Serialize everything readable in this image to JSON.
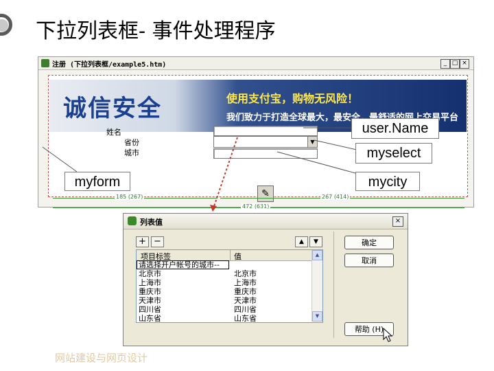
{
  "slide": {
    "title": "下拉列表框- 事件处理程序",
    "footer": "网站建设与网页设计"
  },
  "editor": {
    "title": "注册 (下拉列表框/example5.htm)",
    "controls": [
      "_",
      "□",
      "×"
    ],
    "banner": {
      "logo": "诚信安全",
      "line1": "使用支付宝，购物无风险！",
      "line2": "我们致力于打造全球最大，最安全，最舒适的网上交易平台"
    },
    "fields": [
      {
        "label": "姓名"
      },
      {
        "label": "省份"
      },
      {
        "label": "城市"
      }
    ],
    "rulers": [
      "185 (267)",
      "267 (414)",
      "472 (631)"
    ]
  },
  "callouts": {
    "username": "user.Name",
    "myselect": "myselect",
    "myform": "myform",
    "mycity": "mycity"
  },
  "dialog": {
    "title": "列表值",
    "add": "+",
    "remove": "−",
    "up": "▲",
    "down": "▼",
    "columns": [
      "项目标签",
      "值"
    ],
    "rows": [
      {
        "label": "请选择开户帐号的城市--",
        "value": ""
      },
      {
        "label": "北京市",
        "value": "北京市"
      },
      {
        "label": "上海市",
        "value": "上海市"
      },
      {
        "label": "重庆市",
        "value": "重庆市"
      },
      {
        "label": "天津市",
        "value": "天津市"
      },
      {
        "label": "四川省",
        "value": "四川省"
      },
      {
        "label": "山东省",
        "value": "山东省"
      }
    ],
    "ok": "确定",
    "cancel": "取消",
    "help": "帮助 (H)"
  }
}
